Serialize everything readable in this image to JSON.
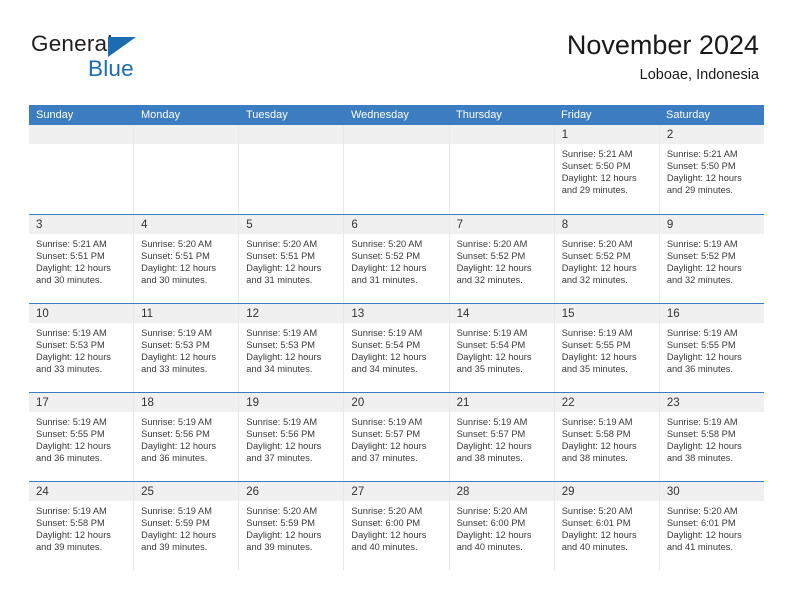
{
  "brand": {
    "name_part1": "General",
    "name_part2": "Blue",
    "accent_color": "#1b6cb0"
  },
  "header": {
    "title": "November 2024",
    "location": "Loboae, Indonesia"
  },
  "theme": {
    "header_bar_color": "#3b7dc0",
    "daynum_band_color": "#f0f0f0",
    "grid_line_color": "#e9e9e9",
    "text_color": "#3a3a3a"
  },
  "weekday_headers": [
    "Sunday",
    "Monday",
    "Tuesday",
    "Wednesday",
    "Thursday",
    "Friday",
    "Saturday"
  ],
  "weeks": [
    [
      {
        "day": "",
        "empty": true,
        "lines": []
      },
      {
        "day": "",
        "empty": true,
        "lines": []
      },
      {
        "day": "",
        "empty": true,
        "lines": []
      },
      {
        "day": "",
        "empty": true,
        "lines": []
      },
      {
        "day": "",
        "empty": true,
        "lines": []
      },
      {
        "day": "1",
        "empty": false,
        "lines": [
          "Sunrise: 5:21 AM",
          "Sunset: 5:50 PM",
          "Daylight: 12 hours",
          "and 29 minutes."
        ]
      },
      {
        "day": "2",
        "empty": false,
        "lines": [
          "Sunrise: 5:21 AM",
          "Sunset: 5:50 PM",
          "Daylight: 12 hours",
          "and 29 minutes."
        ]
      }
    ],
    [
      {
        "day": "3",
        "empty": false,
        "lines": [
          "Sunrise: 5:21 AM",
          "Sunset: 5:51 PM",
          "Daylight: 12 hours",
          "and 30 minutes."
        ]
      },
      {
        "day": "4",
        "empty": false,
        "lines": [
          "Sunrise: 5:20 AM",
          "Sunset: 5:51 PM",
          "Daylight: 12 hours",
          "and 30 minutes."
        ]
      },
      {
        "day": "5",
        "empty": false,
        "lines": [
          "Sunrise: 5:20 AM",
          "Sunset: 5:51 PM",
          "Daylight: 12 hours",
          "and 31 minutes."
        ]
      },
      {
        "day": "6",
        "empty": false,
        "lines": [
          "Sunrise: 5:20 AM",
          "Sunset: 5:52 PM",
          "Daylight: 12 hours",
          "and 31 minutes."
        ]
      },
      {
        "day": "7",
        "empty": false,
        "lines": [
          "Sunrise: 5:20 AM",
          "Sunset: 5:52 PM",
          "Daylight: 12 hours",
          "and 32 minutes."
        ]
      },
      {
        "day": "8",
        "empty": false,
        "lines": [
          "Sunrise: 5:20 AM",
          "Sunset: 5:52 PM",
          "Daylight: 12 hours",
          "and 32 minutes."
        ]
      },
      {
        "day": "9",
        "empty": false,
        "lines": [
          "Sunrise: 5:19 AM",
          "Sunset: 5:52 PM",
          "Daylight: 12 hours",
          "and 32 minutes."
        ]
      }
    ],
    [
      {
        "day": "10",
        "empty": false,
        "lines": [
          "Sunrise: 5:19 AM",
          "Sunset: 5:53 PM",
          "Daylight: 12 hours",
          "and 33 minutes."
        ]
      },
      {
        "day": "11",
        "empty": false,
        "lines": [
          "Sunrise: 5:19 AM",
          "Sunset: 5:53 PM",
          "Daylight: 12 hours",
          "and 33 minutes."
        ]
      },
      {
        "day": "12",
        "empty": false,
        "lines": [
          "Sunrise: 5:19 AM",
          "Sunset: 5:53 PM",
          "Daylight: 12 hours",
          "and 34 minutes."
        ]
      },
      {
        "day": "13",
        "empty": false,
        "lines": [
          "Sunrise: 5:19 AM",
          "Sunset: 5:54 PM",
          "Daylight: 12 hours",
          "and 34 minutes."
        ]
      },
      {
        "day": "14",
        "empty": false,
        "lines": [
          "Sunrise: 5:19 AM",
          "Sunset: 5:54 PM",
          "Daylight: 12 hours",
          "and 35 minutes."
        ]
      },
      {
        "day": "15",
        "empty": false,
        "lines": [
          "Sunrise: 5:19 AM",
          "Sunset: 5:55 PM",
          "Daylight: 12 hours",
          "and 35 minutes."
        ]
      },
      {
        "day": "16",
        "empty": false,
        "lines": [
          "Sunrise: 5:19 AM",
          "Sunset: 5:55 PM",
          "Daylight: 12 hours",
          "and 36 minutes."
        ]
      }
    ],
    [
      {
        "day": "17",
        "empty": false,
        "lines": [
          "Sunrise: 5:19 AM",
          "Sunset: 5:55 PM",
          "Daylight: 12 hours",
          "and 36 minutes."
        ]
      },
      {
        "day": "18",
        "empty": false,
        "lines": [
          "Sunrise: 5:19 AM",
          "Sunset: 5:56 PM",
          "Daylight: 12 hours",
          "and 36 minutes."
        ]
      },
      {
        "day": "19",
        "empty": false,
        "lines": [
          "Sunrise: 5:19 AM",
          "Sunset: 5:56 PM",
          "Daylight: 12 hours",
          "and 37 minutes."
        ]
      },
      {
        "day": "20",
        "empty": false,
        "lines": [
          "Sunrise: 5:19 AM",
          "Sunset: 5:57 PM",
          "Daylight: 12 hours",
          "and 37 minutes."
        ]
      },
      {
        "day": "21",
        "empty": false,
        "lines": [
          "Sunrise: 5:19 AM",
          "Sunset: 5:57 PM",
          "Daylight: 12 hours",
          "and 38 minutes."
        ]
      },
      {
        "day": "22",
        "empty": false,
        "lines": [
          "Sunrise: 5:19 AM",
          "Sunset: 5:58 PM",
          "Daylight: 12 hours",
          "and 38 minutes."
        ]
      },
      {
        "day": "23",
        "empty": false,
        "lines": [
          "Sunrise: 5:19 AM",
          "Sunset: 5:58 PM",
          "Daylight: 12 hours",
          "and 38 minutes."
        ]
      }
    ],
    [
      {
        "day": "24",
        "empty": false,
        "lines": [
          "Sunrise: 5:19 AM",
          "Sunset: 5:58 PM",
          "Daylight: 12 hours",
          "and 39 minutes."
        ]
      },
      {
        "day": "25",
        "empty": false,
        "lines": [
          "Sunrise: 5:19 AM",
          "Sunset: 5:59 PM",
          "Daylight: 12 hours",
          "and 39 minutes."
        ]
      },
      {
        "day": "26",
        "empty": false,
        "lines": [
          "Sunrise: 5:20 AM",
          "Sunset: 5:59 PM",
          "Daylight: 12 hours",
          "and 39 minutes."
        ]
      },
      {
        "day": "27",
        "empty": false,
        "lines": [
          "Sunrise: 5:20 AM",
          "Sunset: 6:00 PM",
          "Daylight: 12 hours",
          "and 40 minutes."
        ]
      },
      {
        "day": "28",
        "empty": false,
        "lines": [
          "Sunrise: 5:20 AM",
          "Sunset: 6:00 PM",
          "Daylight: 12 hours",
          "and 40 minutes."
        ]
      },
      {
        "day": "29",
        "empty": false,
        "lines": [
          "Sunrise: 5:20 AM",
          "Sunset: 6:01 PM",
          "Daylight: 12 hours",
          "and 40 minutes."
        ]
      },
      {
        "day": "30",
        "empty": false,
        "lines": [
          "Sunrise: 5:20 AM",
          "Sunset: 6:01 PM",
          "Daylight: 12 hours",
          "and 41 minutes."
        ]
      }
    ]
  ]
}
